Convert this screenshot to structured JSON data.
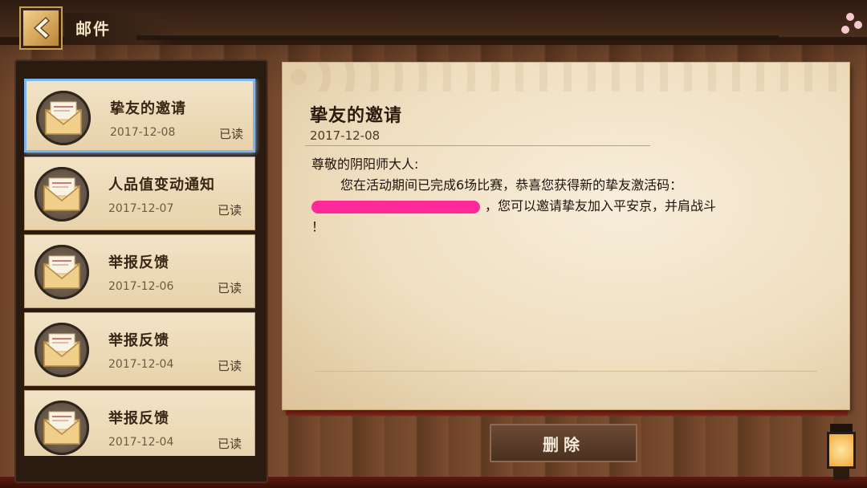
{
  "header": {
    "title": "邮件",
    "back_icon": "back-arrow-icon"
  },
  "mail_list": [
    {
      "title": "挚友的邀请",
      "date": "2017-12-08",
      "status": "已读",
      "selected": true
    },
    {
      "title": "人品值变动通知",
      "date": "2017-12-07",
      "status": "已读",
      "selected": false
    },
    {
      "title": "举报反馈",
      "date": "2017-12-06",
      "status": "已读",
      "selected": false
    },
    {
      "title": "举报反馈",
      "date": "2017-12-04",
      "status": "已读",
      "selected": false
    },
    {
      "title": "举报反馈",
      "date": "2017-12-04",
      "status": "已读",
      "selected": false
    }
  ],
  "letter": {
    "title": "挚友的邀请",
    "date": "2017-12-08",
    "greeting": "尊敬的阴阳师大人:",
    "line1": "您在活动期间已完成6场比赛，恭喜您获得新的挚友激活码：",
    "line2_after_code": "，您可以邀请挚友加入平安京，并肩战斗",
    "line3": "！"
  },
  "actions": {
    "delete_label": "删除"
  },
  "colors": {
    "redaction": "#ff2a9a",
    "selected_border": "#7bb6f0"
  }
}
